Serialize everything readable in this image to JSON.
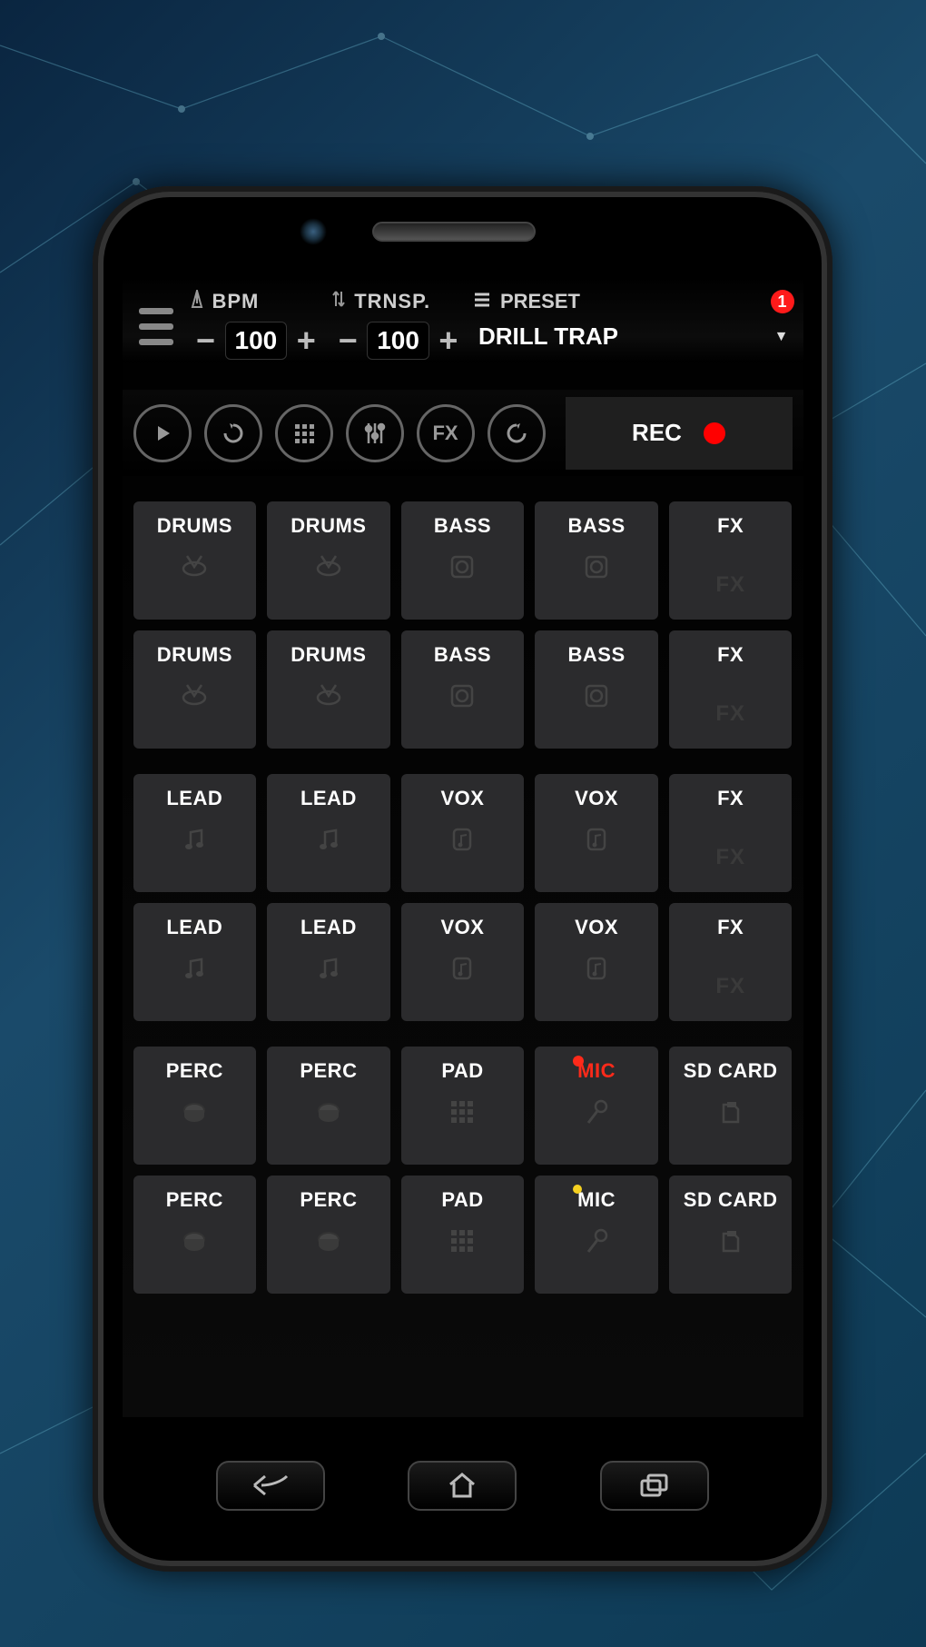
{
  "topbar": {
    "bpm": {
      "label": "BPM",
      "value": "100"
    },
    "transpose": {
      "label": "TRNSP.",
      "value": "100"
    },
    "preset": {
      "label": "PRESET",
      "notification": "1",
      "value": "DRILL TRAP"
    }
  },
  "transport": {
    "fx_label": "FX",
    "rec_label": "REC"
  },
  "pads": {
    "groups": [
      {
        "rows": [
          [
            {
              "label": "DRUMS",
              "icon": "drum"
            },
            {
              "label": "DRUMS",
              "icon": "drum"
            },
            {
              "label": "BASS",
              "icon": "speaker"
            },
            {
              "label": "BASS",
              "icon": "speaker"
            },
            {
              "label": "FX",
              "icon": "fx"
            }
          ],
          [
            {
              "label": "DRUMS",
              "icon": "drum"
            },
            {
              "label": "DRUMS",
              "icon": "drum"
            },
            {
              "label": "BASS",
              "icon": "speaker"
            },
            {
              "label": "BASS",
              "icon": "speaker"
            },
            {
              "label": "FX",
              "icon": "fx"
            }
          ]
        ]
      },
      {
        "rows": [
          [
            {
              "label": "LEAD",
              "icon": "note"
            },
            {
              "label": "LEAD",
              "icon": "note"
            },
            {
              "label": "VOX",
              "icon": "vox"
            },
            {
              "label": "VOX",
              "icon": "vox"
            },
            {
              "label": "FX",
              "icon": "fx"
            }
          ],
          [
            {
              "label": "LEAD",
              "icon": "note"
            },
            {
              "label": "LEAD",
              "icon": "note"
            },
            {
              "label": "VOX",
              "icon": "vox"
            },
            {
              "label": "VOX",
              "icon": "vox"
            },
            {
              "label": "FX",
              "icon": "fx"
            }
          ]
        ]
      },
      {
        "rows": [
          [
            {
              "label": "PERC",
              "icon": "perc"
            },
            {
              "label": "PERC",
              "icon": "perc"
            },
            {
              "label": "PAD",
              "icon": "grid"
            },
            {
              "label": "MIC",
              "icon": "mic",
              "red": true,
              "dot": "red"
            },
            {
              "label": "SD CARD",
              "icon": "sd"
            }
          ],
          [
            {
              "label": "PERC",
              "icon": "perc"
            },
            {
              "label": "PERC",
              "icon": "perc"
            },
            {
              "label": "PAD",
              "icon": "grid"
            },
            {
              "label": "MIC",
              "icon": "mic",
              "dot": "yellow"
            },
            {
              "label": "SD CARD",
              "icon": "sd"
            }
          ]
        ]
      }
    ]
  }
}
